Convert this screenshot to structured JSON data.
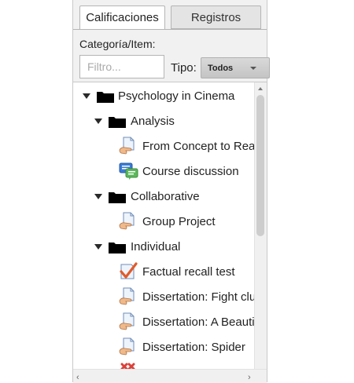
{
  "tabs": [
    {
      "label": "Calificaciones",
      "active": true
    },
    {
      "label": "Registros",
      "active": false
    }
  ],
  "filter_section": {
    "category_label": "Categoría/Item:",
    "filter_placeholder": "Filtro...",
    "type_label": "Tipo:",
    "type_selected": "Todos"
  },
  "tree": {
    "course": "Psychology in Cinema",
    "analysis": {
      "label": "Analysis",
      "items": [
        "From Concept to Reality",
        "Course discussion"
      ]
    },
    "collaborative": {
      "label": "Collaborative",
      "items": [
        "Group Project"
      ]
    },
    "individual": {
      "label": "Individual",
      "items": [
        "Factual recall test",
        "Dissertation: Fight club",
        "Dissertation: A Beautiful Mind",
        "Dissertation: Spider"
      ]
    }
  },
  "colors": {
    "tab_active_bg": "#ffffff",
    "tab_inactive_bg": "#e4e4e4",
    "panel_bg": "#f1f1f1",
    "quiz_check": "#e05a2b",
    "forum_blue": "#3a7bd5",
    "forum_green": "#5cb85c"
  }
}
